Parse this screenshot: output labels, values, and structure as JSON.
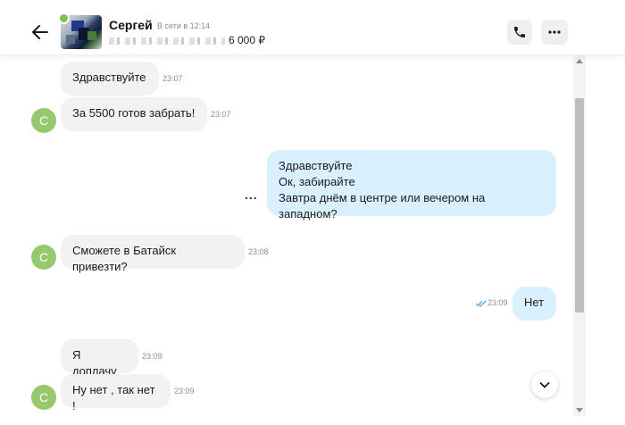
{
  "header": {
    "contact_name": "Сергей",
    "status": "В сети в 12:14",
    "listing_price": "6 000 ₽",
    "avatar_letter": "C"
  },
  "messages": [
    {
      "dir": "in",
      "text": "Здравствуйте",
      "time": "23:07"
    },
    {
      "dir": "in",
      "text": "За 5500 готов забрать!",
      "time": "23:07"
    },
    {
      "dir": "out",
      "lines": [
        "Здравствуйте",
        "Ок, забирайте",
        "Завтра днём в центре или вечером на западном?"
      ]
    },
    {
      "dir": "in",
      "text": "Сможете в Батайск привезти?",
      "time": "23:08"
    },
    {
      "dir": "out",
      "text": "Нет",
      "time": "23:09",
      "read": true
    },
    {
      "dir": "in",
      "text": "Я доплачу",
      "time": "23:09"
    },
    {
      "dir": "in",
      "text": "Ну нет , так нет !",
      "time": "23:09"
    }
  ],
  "more_dots": "...",
  "colors": {
    "incoming_bubble": "#f2f2f2",
    "outgoing_bubble": "#d9f1ff",
    "avatar_green": "#96c96e",
    "read_check": "#3aa0e6"
  },
  "icons": {
    "back": "arrow-left-icon",
    "call": "phone-icon",
    "more": "more-horizontal-icon",
    "scroll_down": "chevron-down-icon",
    "read": "double-check-icon"
  }
}
